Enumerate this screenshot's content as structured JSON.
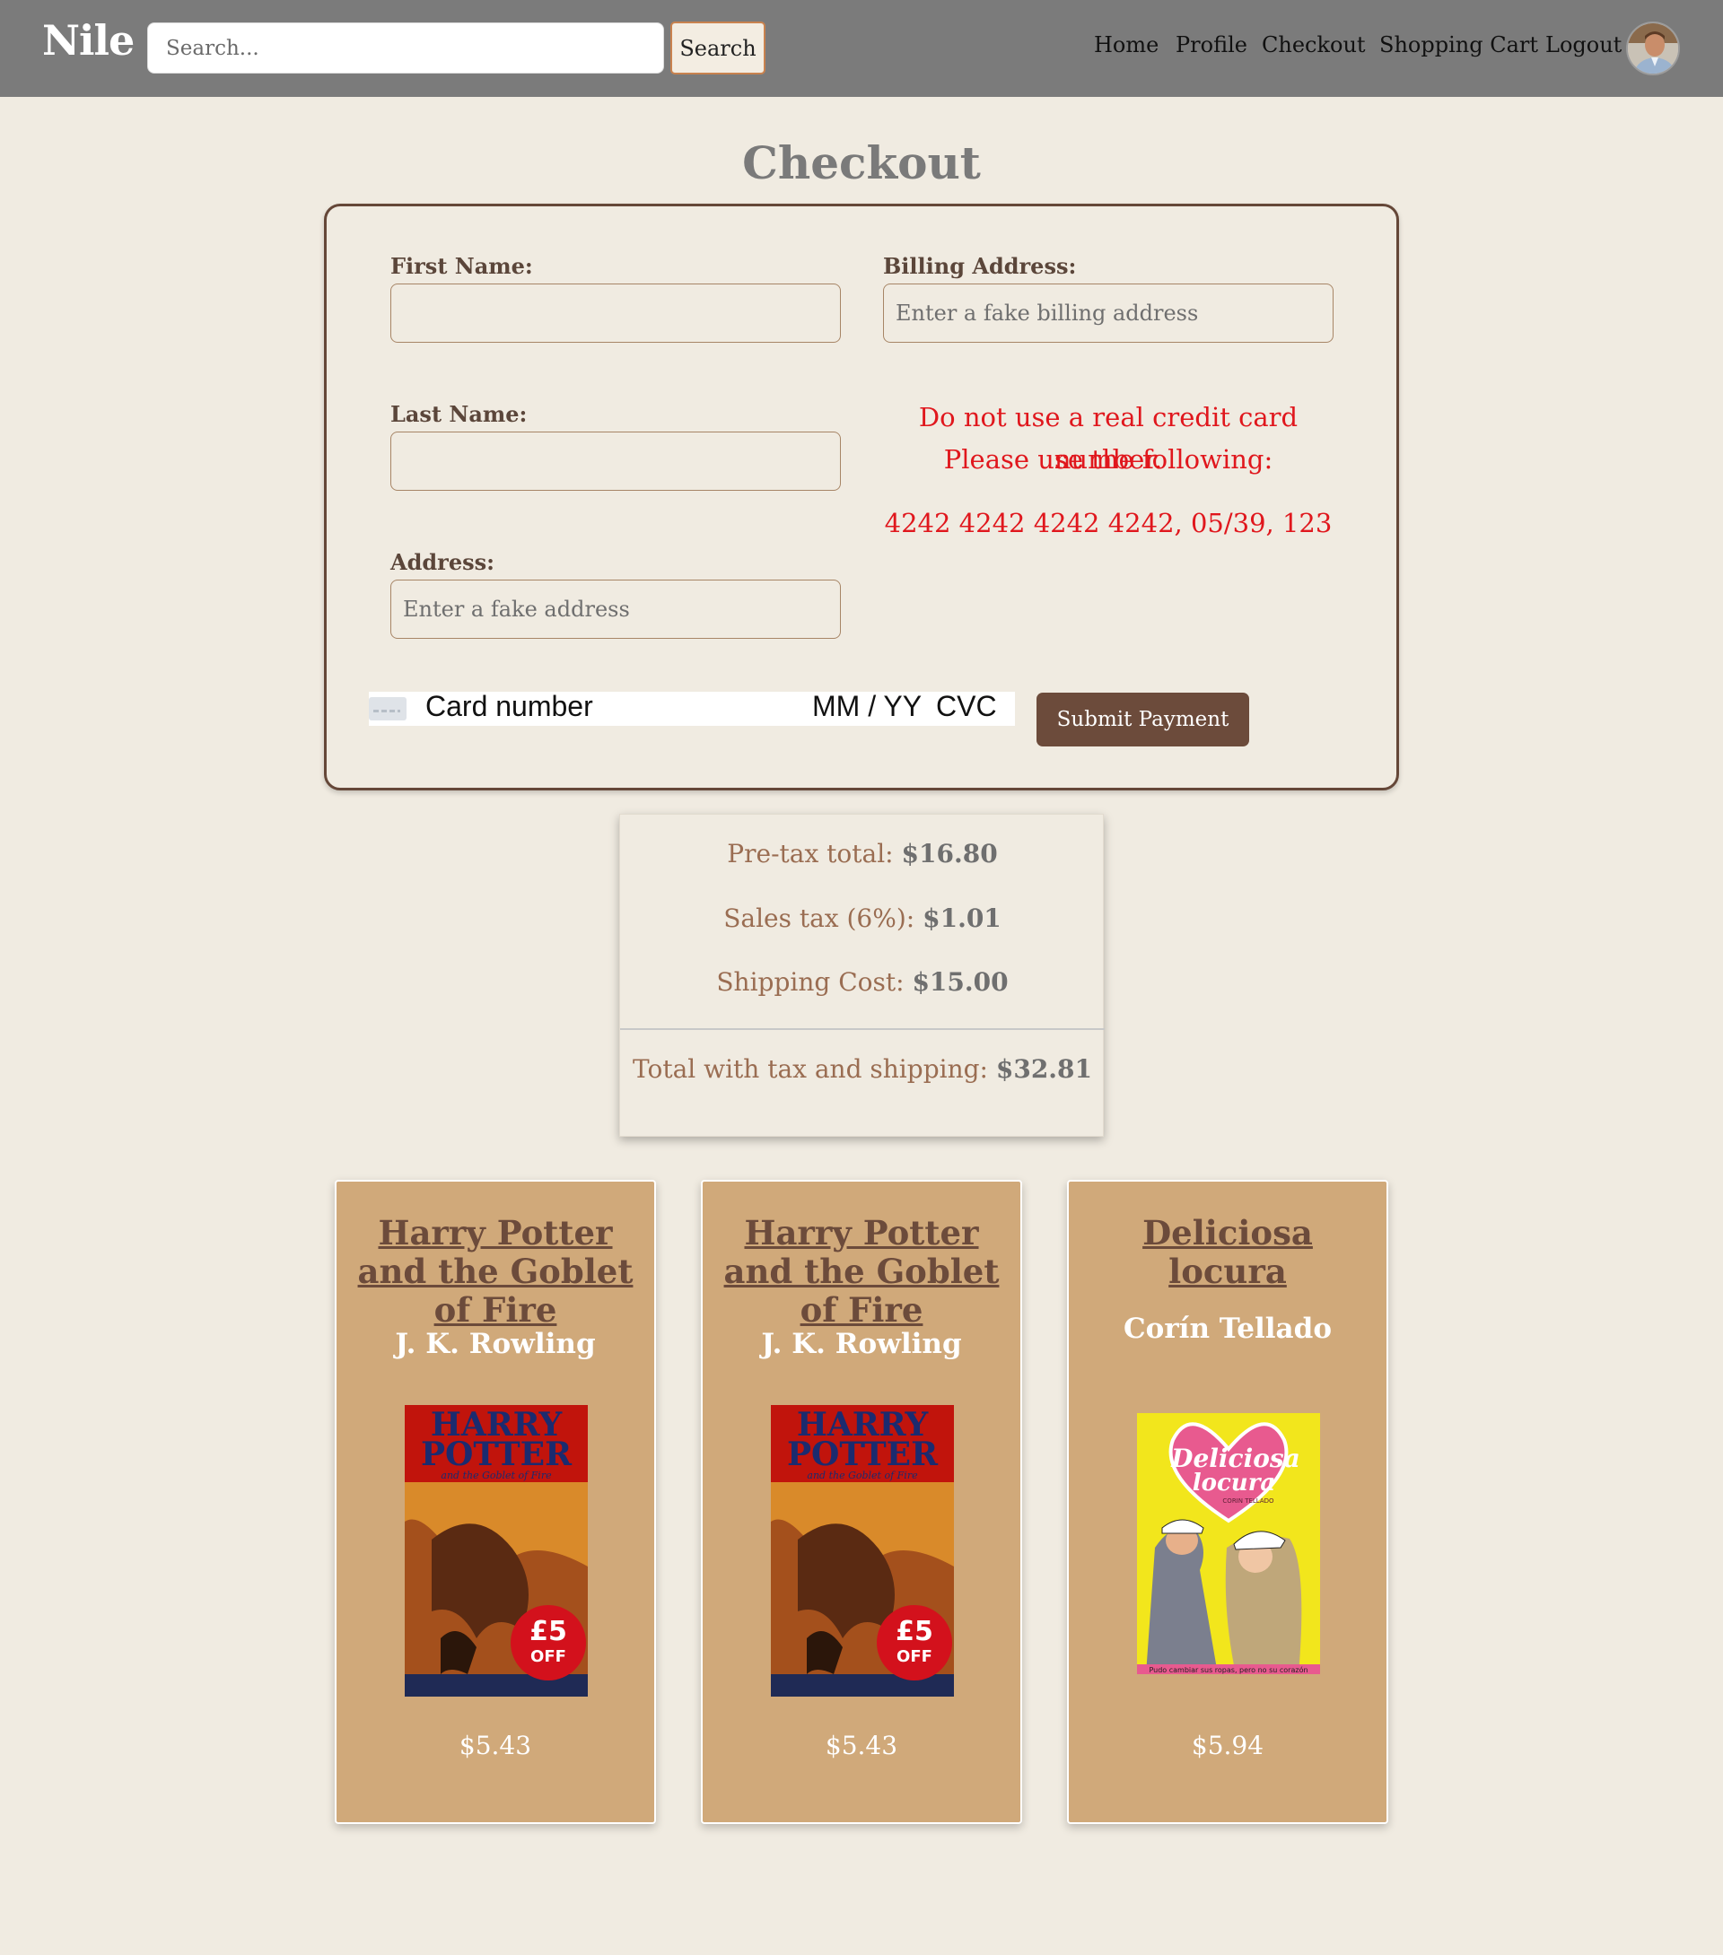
{
  "nav": {
    "brand": "Nile",
    "search_placeholder": "Search...",
    "search_button": "Search",
    "links": [
      "Home",
      "Profile",
      "Checkout",
      "Shopping Cart",
      "Logout"
    ]
  },
  "page_title": "Checkout",
  "form": {
    "first_name_label": "First Name:",
    "last_name_label": "Last Name:",
    "address_label": "Address:",
    "address_placeholder": "Enter a fake address",
    "billing_label": "Billing Address:",
    "billing_placeholder": "Enter a fake billing address",
    "warning_line1": "Do not use a real credit card number.",
    "warning_line2": "Please use the following:",
    "test_card": "4242 4242 4242 4242, 05/39, 123",
    "card_number_placeholder": "Card number",
    "expiry_placeholder": "MM / YY",
    "cvc_placeholder": "CVC",
    "submit_button": "Submit Payment"
  },
  "totals": {
    "pretax_label": "Pre-tax total: ",
    "pretax_value": "$16.80",
    "tax_label": "Sales tax (6%): ",
    "tax_value": "$1.01",
    "shipping_label": "Shipping Cost: ",
    "shipping_value": "$15.00",
    "grand_label": "Total with tax and shipping: ",
    "grand_value": "$32.81"
  },
  "products": [
    {
      "title": "Harry Potter and the Goblet of Fire",
      "author": "J. K. Rowling",
      "price": "$5.43",
      "cover": "harry-potter-cover"
    },
    {
      "title": "Harry Potter and the Goblet of Fire",
      "author": "J. K. Rowling",
      "price": "$5.43",
      "cover": "harry-potter-cover"
    },
    {
      "title": "Deliciosa locura",
      "author": "Corín Tellado",
      "price": "$5.94",
      "cover": "deliciosa-locura-cover"
    }
  ],
  "cover_art": {
    "hp_line1": "HARRY",
    "hp_line2": "POTTER",
    "hp_subtitle": "and the Goblet of Fire",
    "hp_badge_big": "£5",
    "hp_badge_small": "OFF",
    "dl_title_1": "Deliciosa",
    "dl_title_2": "locura",
    "dl_author": "CORIN TELLADO",
    "dl_footer": "Pudo cambiar sus ropas, pero no su corazón"
  },
  "colors": {
    "navbar": "#7b7b7b",
    "background": "#f0ebe1",
    "accent_brown": "#6c4b3b",
    "card_tan": "#d0a97a",
    "warning_red": "#e0171d"
  }
}
